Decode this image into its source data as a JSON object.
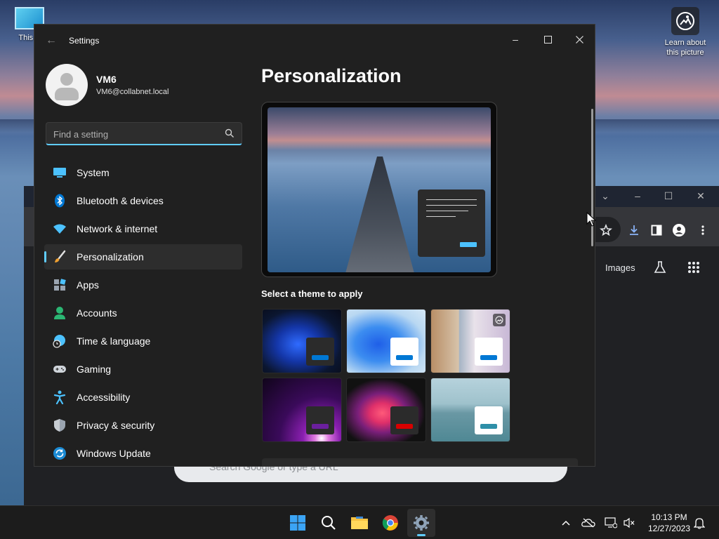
{
  "desktop": {
    "this_pc_label": "This P",
    "learn_label_line1": "Learn about",
    "learn_label_line2": "this picture"
  },
  "chrome": {
    "images_link": "Images",
    "search_placeholder": "Search Google or type a URL"
  },
  "settings": {
    "window_title": "Settings",
    "user": {
      "name": "VM6",
      "email": "VM6@collabnet.local"
    },
    "search": {
      "placeholder": "Find a setting",
      "value": ""
    },
    "nav": [
      {
        "label": "System",
        "icon": "system-monitor-icon",
        "active": false
      },
      {
        "label": "Bluetooth & devices",
        "icon": "bluetooth-icon",
        "active": false
      },
      {
        "label": "Network & internet",
        "icon": "wifi-icon",
        "active": false
      },
      {
        "label": "Personalization",
        "icon": "paintbrush-icon",
        "active": true
      },
      {
        "label": "Apps",
        "icon": "apps-icon",
        "active": false
      },
      {
        "label": "Accounts",
        "icon": "accounts-icon",
        "active": false
      },
      {
        "label": "Time & language",
        "icon": "globe-clock-icon",
        "active": false
      },
      {
        "label": "Gaming",
        "icon": "gamepad-icon",
        "active": false
      },
      {
        "label": "Accessibility",
        "icon": "accessibility-icon",
        "active": false
      },
      {
        "label": "Privacy & security",
        "icon": "shield-icon",
        "active": false
      },
      {
        "label": "Windows Update",
        "icon": "update-icon",
        "active": false
      }
    ],
    "page_title": "Personalization",
    "theme_section_label": "Select a theme to apply",
    "themes": [
      {
        "name": "windows-dark-theme",
        "accent": "#0078d4"
      },
      {
        "name": "windows-light-theme",
        "accent": "#0078d4"
      },
      {
        "name": "windows-spotlight-theme",
        "accent": "#0078d4"
      },
      {
        "name": "glow-theme",
        "accent": "#6b1f9e"
      },
      {
        "name": "captured-motion-theme",
        "accent": "#d90000"
      },
      {
        "name": "flow-theme",
        "accent": "#2e8fa8"
      }
    ],
    "colors": {
      "accent": "#60cdff",
      "background": "#202020",
      "nav_active": "#2d2d2d"
    }
  },
  "taskbar": {
    "time": "10:13 PM",
    "date": "12/27/2023"
  }
}
